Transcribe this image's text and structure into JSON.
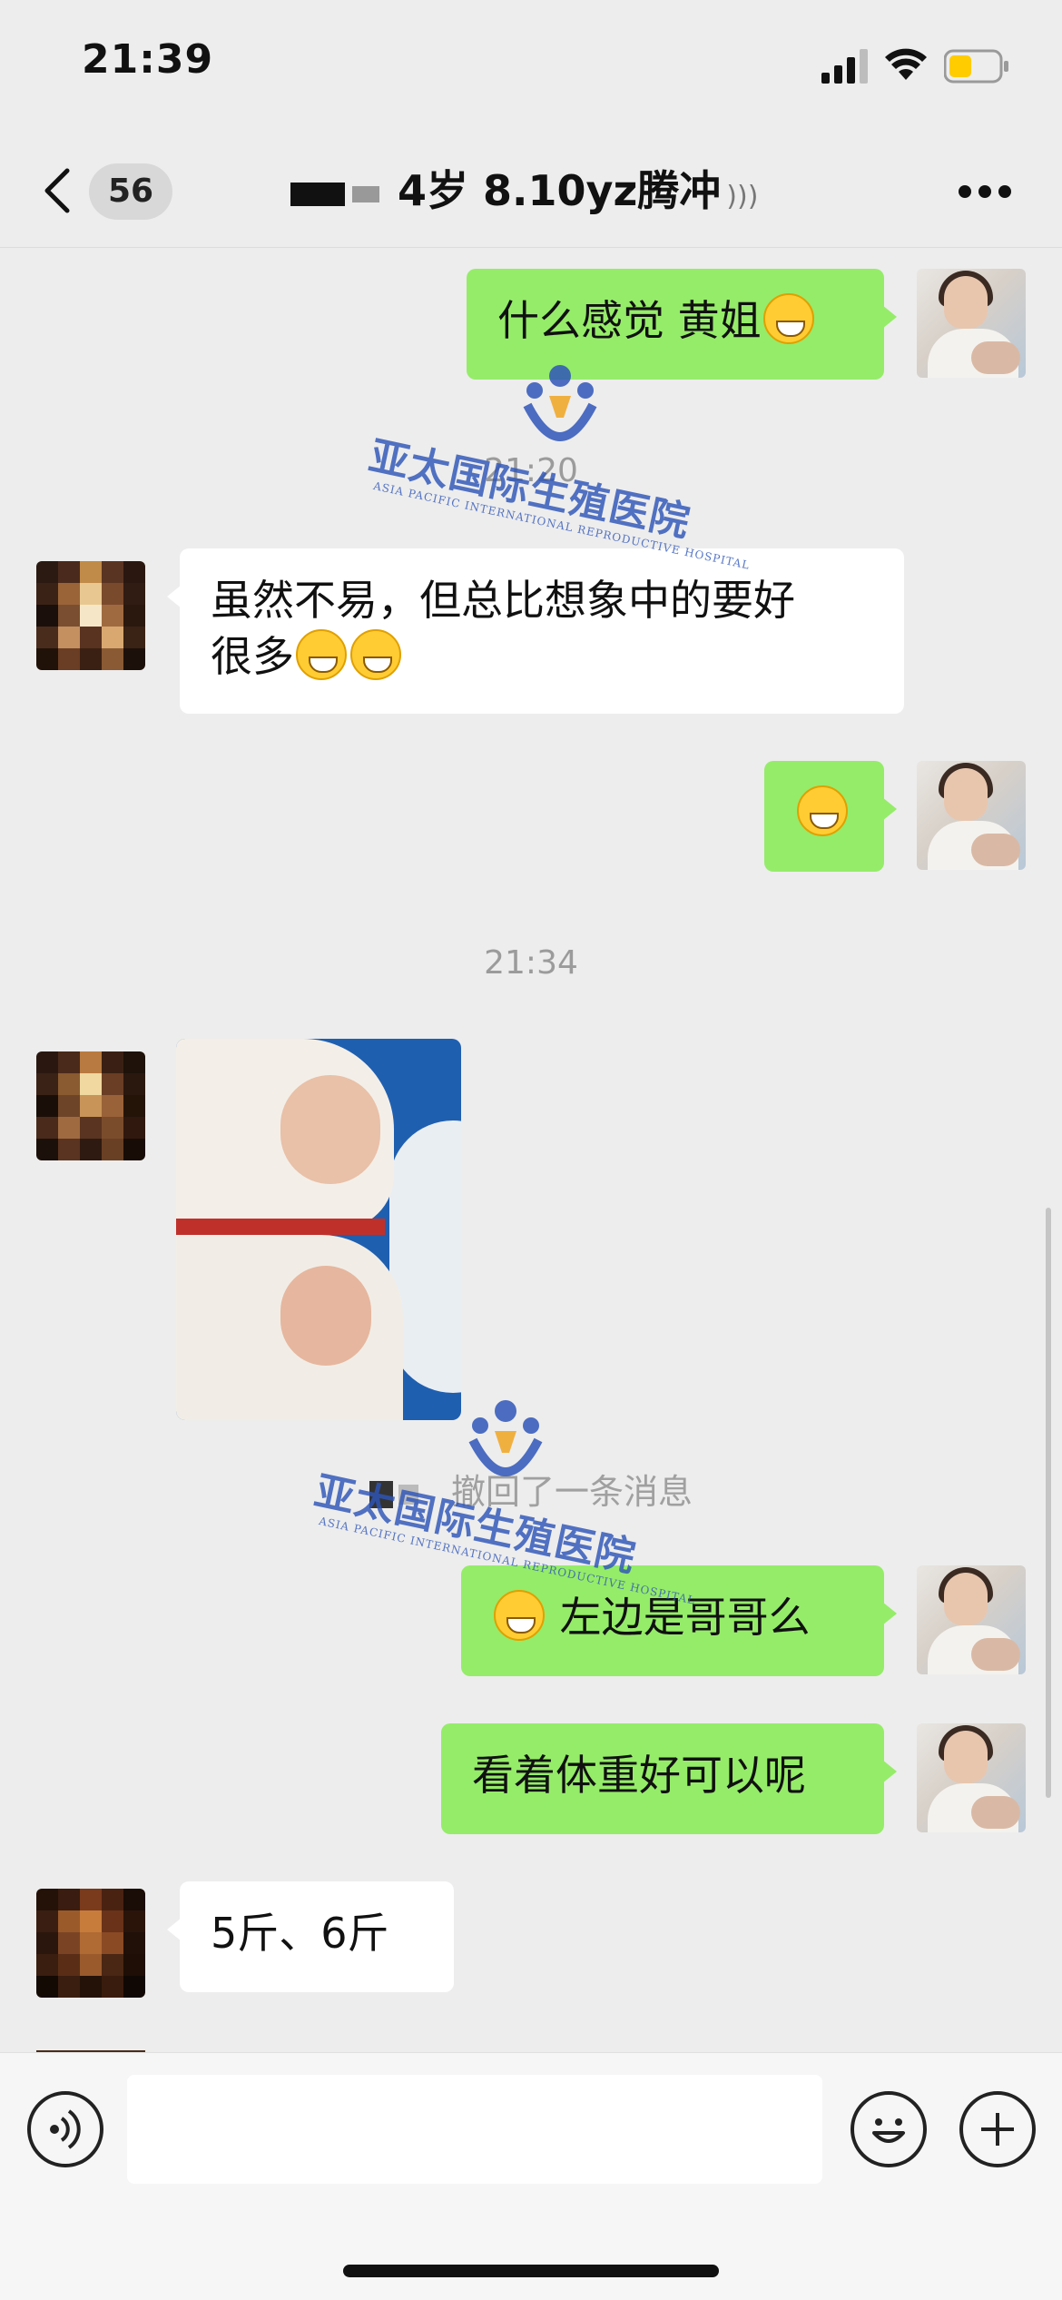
{
  "status_bar": {
    "time": "21:39",
    "signal_icon": "cellular-signal-icon",
    "wifi_icon": "wifi-icon",
    "battery_icon": "battery-low-icon"
  },
  "header": {
    "back_icon": "chevron-left-icon",
    "unread_count": "56",
    "title": "4岁 8.10yz腾冲",
    "voice_indicator_icon": "earpiece-mode-icon",
    "more_icon": "more-dots-icon"
  },
  "messages": [
    {
      "side": "me",
      "text": "什么感觉 黄姐",
      "emoji": "grinning-face-icon"
    },
    {
      "type": "timestamp",
      "text": "21:20"
    },
    {
      "side": "other",
      "line1": "虽然不易，但总比想象中的要好",
      "line2": "很多",
      "emoji": "grinning-face-icon"
    },
    {
      "side": "me",
      "text": "",
      "emoji": "grinning-face-icon"
    },
    {
      "type": "timestamp",
      "text": "21:34"
    },
    {
      "side": "other",
      "type": "image",
      "image_desc": "twin-newborns-photo"
    },
    {
      "type": "system",
      "text": "撤回了一条消息"
    },
    {
      "side": "me",
      "text": "左边是哥哥么",
      "emoji": "grinning-face-icon"
    },
    {
      "side": "me",
      "text": "看着体重好可以呢"
    },
    {
      "side": "other",
      "text": "5斤、6斤"
    }
  ],
  "watermark": {
    "text": "亚太国际生殖医院",
    "subtext": "ASIA PACIFIC INTERNATIONAL REPRODUCTIVE HOSPITAL"
  },
  "input_bar": {
    "voice_icon": "voice-input-icon",
    "input_value": "",
    "emoji_icon": "smiley-icon",
    "plus_icon": "plus-circle-icon"
  },
  "colors": {
    "me_bubble": "#95ec69",
    "other_bubble": "#ffffff",
    "background": "#ededed",
    "watermark": "#2e55b8"
  }
}
